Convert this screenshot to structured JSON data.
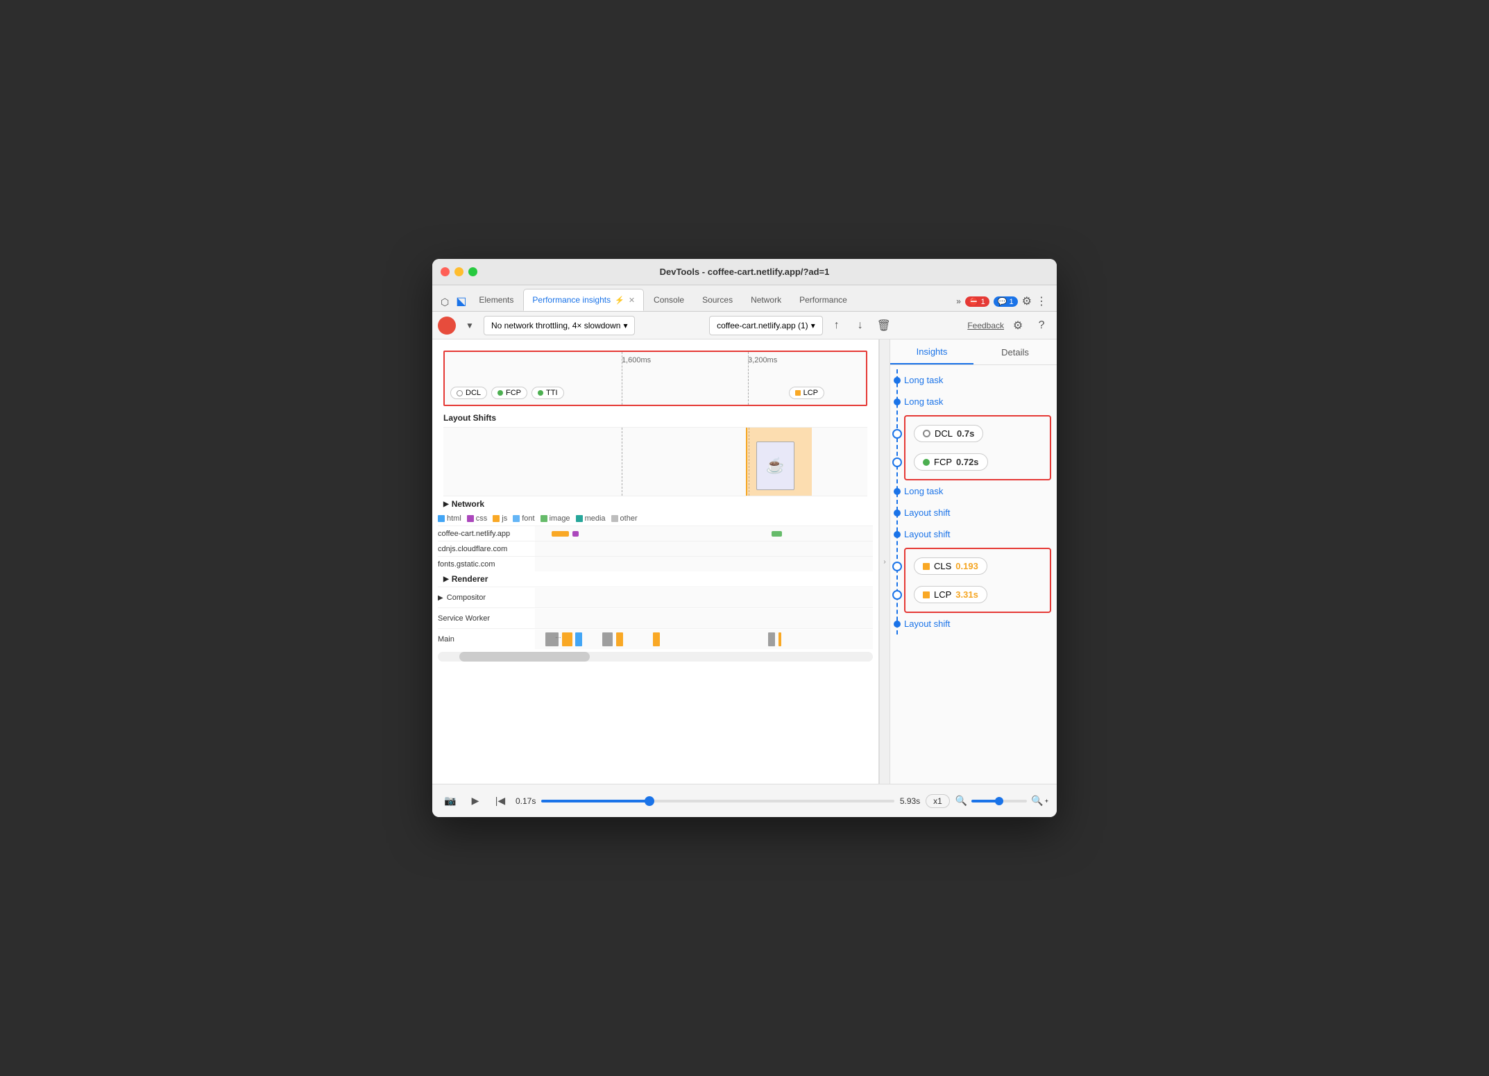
{
  "window": {
    "title": "DevTools - coffee-cart.netlify.app/?ad=1"
  },
  "tabs": [
    {
      "id": "elements",
      "label": "Elements",
      "active": false
    },
    {
      "id": "performance-insights",
      "label": "Performance insights",
      "active": true,
      "closable": true
    },
    {
      "id": "console",
      "label": "Console",
      "active": false
    },
    {
      "id": "sources",
      "label": "Sources",
      "active": false
    },
    {
      "id": "network",
      "label": "Network",
      "active": false
    },
    {
      "id": "performance",
      "label": "Performance",
      "active": false
    }
  ],
  "toolbar": {
    "network_throttling": "No network throttling, 4× slowdown",
    "url": "coffee-cart.netlify.app (1)",
    "feedback": "Feedback"
  },
  "timeline": {
    "marker_1600": "1,600ms",
    "marker_3200": "3,200ms",
    "chips": {
      "dcl": "DCL",
      "fcp": "FCP",
      "tti": "TTI",
      "lcp": "LCP"
    }
  },
  "sections": {
    "layout_shifts": "Layout Shifts",
    "network": "Network",
    "renderer": "Renderer",
    "compositor": "Compositor",
    "service_worker": "Service Worker",
    "main": "Main"
  },
  "network_legend": [
    {
      "color": "#42a5f5",
      "label": "html"
    },
    {
      "color": "#ab47bc",
      "label": "css"
    },
    {
      "color": "#f9a825",
      "label": "js"
    },
    {
      "color": "#42a5f5",
      "label": "font"
    },
    {
      "color": "#66bb6a",
      "label": "image"
    },
    {
      "color": "#26a69a",
      "label": "media"
    },
    {
      "color": "#bdbdbd",
      "label": "other"
    }
  ],
  "network_rows": [
    {
      "label": "coffee-cart.netlify.app"
    },
    {
      "label": "cdnjs.cloudflare.com"
    },
    {
      "label": "fonts.gstatic.com"
    }
  ],
  "playback": {
    "start_time": "0.17s",
    "end_time": "5.93s",
    "speed": "x1"
  },
  "insights": {
    "tabs": [
      "Insights",
      "Details"
    ],
    "items": [
      {
        "type": "link",
        "label": "Long task"
      },
      {
        "type": "link",
        "label": "Long task"
      },
      {
        "type": "metric",
        "metric": "DCL",
        "value": "0.7s",
        "color": "ring"
      },
      {
        "type": "metric",
        "metric": "FCP",
        "value": "0.72s",
        "color": "green"
      },
      {
        "type": "link",
        "label": "Long task"
      },
      {
        "type": "link",
        "label": "Layout shift"
      },
      {
        "type": "link",
        "label": "Layout shift"
      },
      {
        "type": "metric",
        "metric": "CLS",
        "value": "0.193",
        "color": "orange",
        "shape": "square"
      },
      {
        "type": "metric",
        "metric": "LCP",
        "value": "3.31s",
        "color": "orange",
        "shape": "square"
      },
      {
        "type": "link",
        "label": "Layout shift"
      }
    ]
  }
}
